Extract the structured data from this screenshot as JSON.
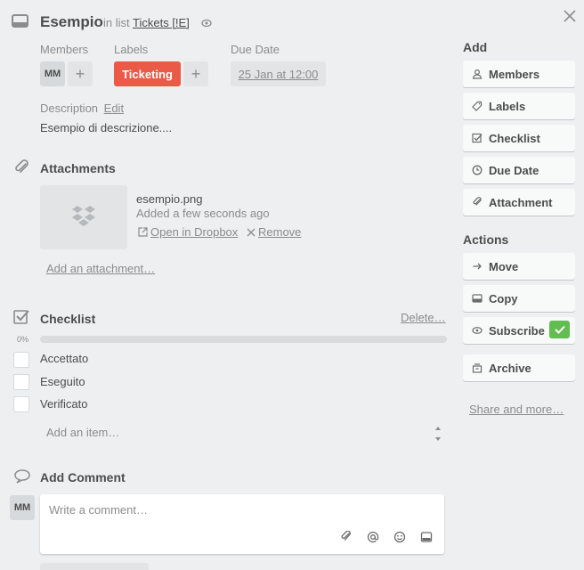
{
  "header": {
    "title": "Esempio",
    "in_list_prefix": "in list",
    "list_name": "Tickets [!E]"
  },
  "details": {
    "members_label": "Members",
    "member_initials": "MM",
    "labels_label": "Labels",
    "label_ticketing": "Ticketing",
    "label_color": "#eb5a46",
    "due_label": "Due Date",
    "due_value": "25 Jan at 12:00",
    "description_label": "Description",
    "description_edit": "Edit",
    "description_text": "Esempio di descrizione...."
  },
  "attachments": {
    "title": "Attachments",
    "file_name": "esempio.png",
    "file_added": "Added a few seconds ago",
    "open_link": "Open in Dropbox",
    "remove_link": "Remove",
    "add_link": "Add an attachment…"
  },
  "checklist": {
    "title": "Checklist",
    "delete_link": "Delete…",
    "progress_text": "0%",
    "progress": 0,
    "items": [
      "Accettato",
      "Eseguito",
      "Verificato"
    ],
    "add_placeholder": "Add an item…"
  },
  "comment": {
    "title": "Add Comment",
    "avatar": "MM",
    "placeholder": "Write a comment…"
  },
  "sidebar": {
    "add_title": "Add",
    "add_buttons": [
      "Members",
      "Labels",
      "Checklist",
      "Due Date",
      "Attachment"
    ],
    "actions_title": "Actions",
    "action_buttons": [
      "Move",
      "Copy",
      "Subscribe",
      "Archive"
    ],
    "share_link": "Share and more…",
    "subscribe_check_color": "#61bd4f"
  }
}
